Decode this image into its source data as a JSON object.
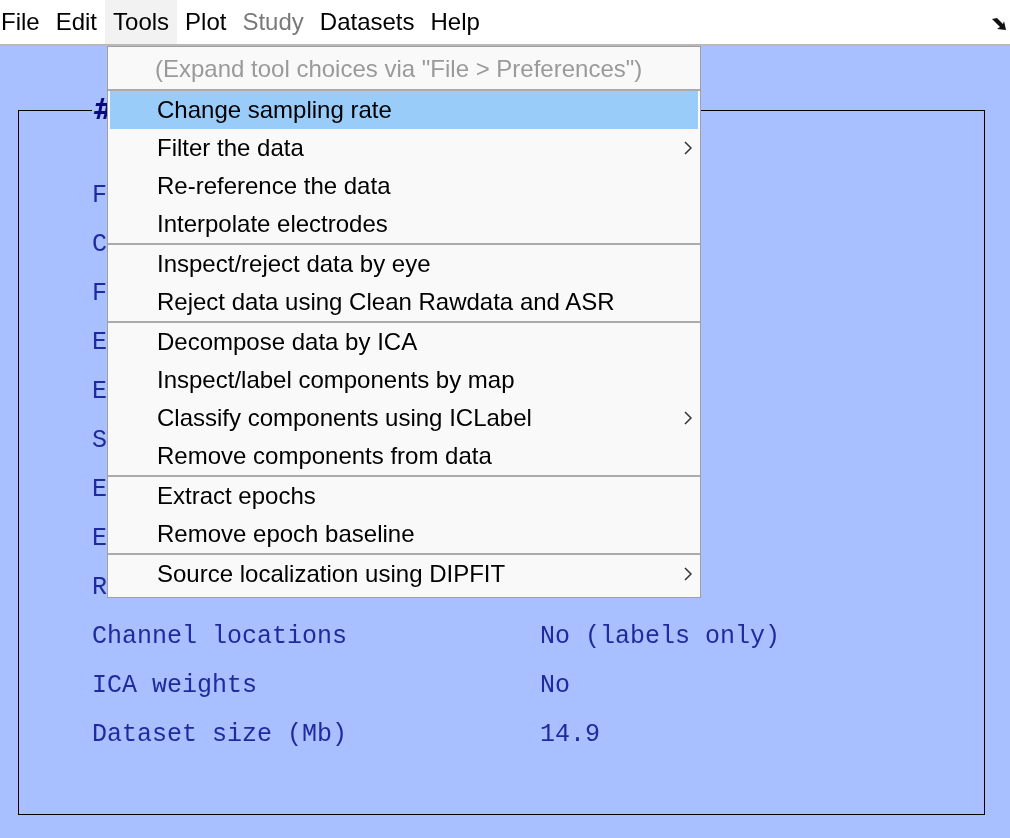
{
  "menubar": [
    {
      "label": "File",
      "open": false,
      "disabled": false
    },
    {
      "label": "Edit",
      "open": false,
      "disabled": false
    },
    {
      "label": "Tools",
      "open": true,
      "disabled": false
    },
    {
      "label": "Plot",
      "open": false,
      "disabled": false
    },
    {
      "label": "Study",
      "open": false,
      "disabled": true
    },
    {
      "label": "Datasets",
      "open": false,
      "disabled": false
    },
    {
      "label": "Help",
      "open": false,
      "disabled": false
    }
  ],
  "panel": {
    "title": "#",
    "rows": [
      {
        "label": "F"
      },
      {
        "label": "C"
      },
      {
        "label": "F"
      },
      {
        "label": "E"
      },
      {
        "label": "E"
      },
      {
        "label": "S"
      },
      {
        "label": "E"
      },
      {
        "label": "E"
      },
      {
        "label": "R"
      },
      {
        "label": "Channel locations",
        "value": "No (labels only)"
      },
      {
        "label": "ICA weights",
        "value": "No"
      },
      {
        "label": "Dataset size (Mb)",
        "value": "14.9"
      }
    ]
  },
  "tools_menu": {
    "hint": "(Expand tool choices via \"File > Preferences\")",
    "sections": [
      [
        {
          "label": "Change sampling rate",
          "selected": true,
          "submenu": false
        },
        {
          "label": "Filter the data",
          "selected": false,
          "submenu": true
        },
        {
          "label": "Re-reference the data",
          "selected": false,
          "submenu": false
        },
        {
          "label": "Interpolate electrodes",
          "selected": false,
          "submenu": false
        }
      ],
      [
        {
          "label": "Inspect/reject data by eye",
          "selected": false,
          "submenu": false
        },
        {
          "label": "Reject data using Clean Rawdata and ASR",
          "selected": false,
          "submenu": false
        }
      ],
      [
        {
          "label": "Decompose data by ICA",
          "selected": false,
          "submenu": false
        },
        {
          "label": "Inspect/label components by map",
          "selected": false,
          "submenu": false
        },
        {
          "label": "Classify components using ICLabel",
          "selected": false,
          "submenu": true
        },
        {
          "label": "Remove components from data",
          "selected": false,
          "submenu": false
        }
      ],
      [
        {
          "label": "Extract epochs",
          "selected": false,
          "submenu": false
        },
        {
          "label": "Remove epoch baseline",
          "selected": false,
          "submenu": false
        }
      ],
      [
        {
          "label": "Source localization using DIPFIT",
          "selected": false,
          "submenu": true
        }
      ]
    ]
  }
}
